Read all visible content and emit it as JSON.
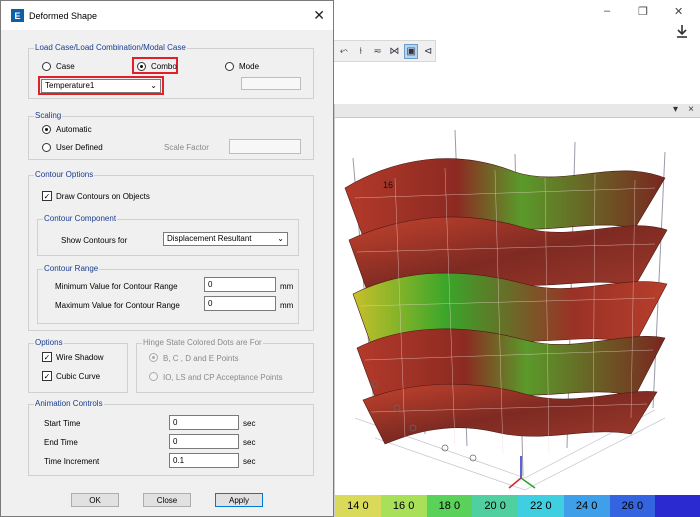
{
  "window_controls": {
    "minimize": "–",
    "restore": "❐",
    "close": "✕"
  },
  "download_icon": "download-icon",
  "viewport": {
    "restore_glyph": "▾",
    "close_glyph": "×",
    "story_label": "16",
    "color_scale": [
      {
        "label": "14 0",
        "color": "#d9d95a"
      },
      {
        "label": "16 0",
        "color": "#a8e05a"
      },
      {
        "label": "18 0",
        "color": "#5ad25a"
      },
      {
        "label": "20 0",
        "color": "#50d0a0"
      },
      {
        "label": "22 0",
        "color": "#3fcfe0"
      },
      {
        "label": "24 0",
        "color": "#3f9fe8"
      },
      {
        "label": "26 0",
        "color": "#3464e0"
      },
      {
        "label": "",
        "color": "#2a2ad0"
      }
    ]
  },
  "dialog": {
    "logo": "E",
    "title": "Deformed Shape",
    "close": "✕",
    "load_case": {
      "title": "Load Case/Load Combination/Modal Case",
      "options": [
        "Case",
        "Combo",
        "Mode"
      ],
      "selected": "Combo",
      "dropdown_value": "Temperature1",
      "mode_value": ""
    },
    "scaling": {
      "title": "Scaling",
      "automatic": "Automatic",
      "user_defined": "User Defined",
      "scale_factor_label": "Scale Factor",
      "scale_factor_value": "",
      "selected": "Automatic"
    },
    "contour_options": {
      "title": "Contour Options",
      "draw_contours": "Draw Contours on Objects",
      "draw_contours_checked": true,
      "component_title": "Contour Component",
      "show_for_label": "Show Contours for",
      "show_for_value": "Displacement Resultant",
      "range_title": "Contour Range",
      "min_label": "Minimum Value for Contour Range",
      "min_value": "0",
      "max_label": "Maximum Value for Contour Range",
      "max_value": "0",
      "unit": "mm"
    },
    "options": {
      "title": "Options",
      "wire_shadow": "Wire Shadow",
      "cubic_curve": "Cubic Curve",
      "wire_shadow_checked": true,
      "cubic_curve_checked": true
    },
    "hinge": {
      "title": "Hinge State Colored Dots are For",
      "opt1": "B, C , D and E Points",
      "opt2": "IO, LS and CP Acceptance Points"
    },
    "animation": {
      "title": "Animation Controls",
      "start_label": "Start Time",
      "start_value": "0",
      "end_label": "End Time",
      "end_value": "0",
      "inc_label": "Time Increment",
      "inc_value": "0.1",
      "unit": "sec"
    },
    "buttons": {
      "ok": "OK",
      "close": "Close",
      "apply": "Apply"
    }
  }
}
